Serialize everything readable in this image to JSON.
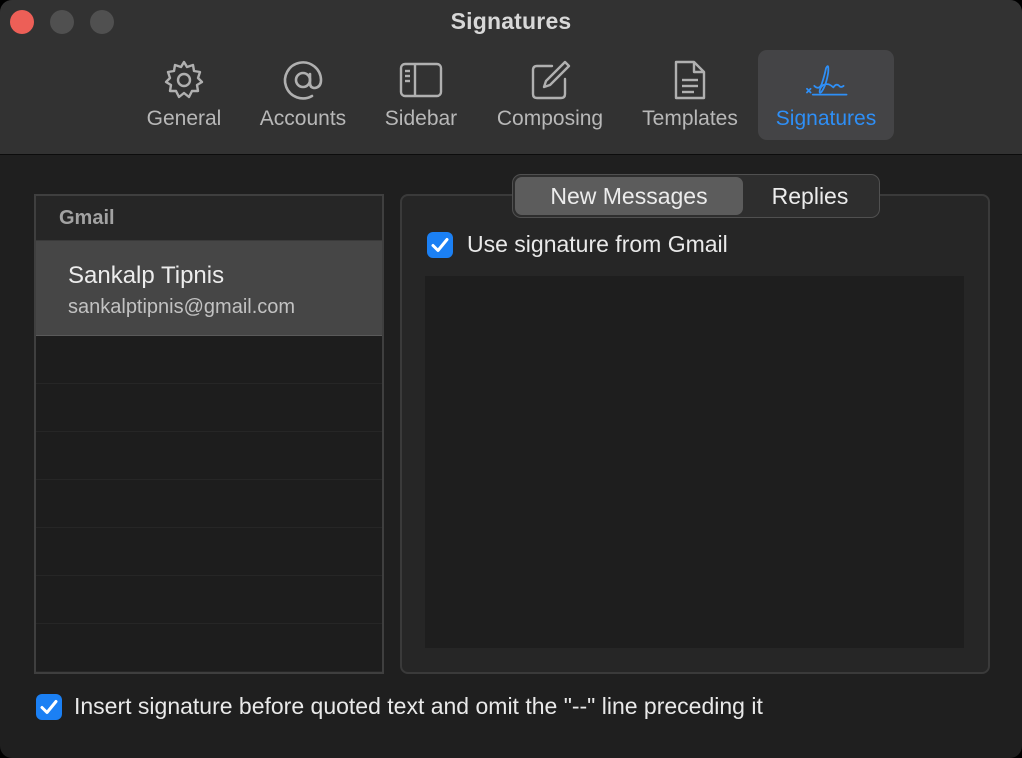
{
  "window": {
    "title": "Signatures"
  },
  "toolbar": {
    "items": [
      {
        "label": "General",
        "icon": "gear-icon"
      },
      {
        "label": "Accounts",
        "icon": "at-sign-icon"
      },
      {
        "label": "Sidebar",
        "icon": "sidebar-icon"
      },
      {
        "label": "Composing",
        "icon": "compose-icon"
      },
      {
        "label": "Templates",
        "icon": "document-icon"
      },
      {
        "label": "Signatures",
        "icon": "signature-icon",
        "active": true
      }
    ],
    "active_color": "#2e8ff7"
  },
  "accounts": {
    "group_label": "Gmail",
    "selected": {
      "name": "Sankalp Tipnis",
      "email": "sankalptipnis@gmail.com"
    }
  },
  "signature_tabs": {
    "new_messages": "New Messages",
    "replies": "Replies",
    "selected": "New Messages"
  },
  "use_signature": {
    "label": "Use signature from Gmail",
    "checked": true
  },
  "insert_before_quoted": {
    "label": "Insert signature before quoted text and omit the \"--\" line preceding it",
    "checked": true
  },
  "colors": {
    "accent": "#1b80f4",
    "close": "#ed5f57"
  }
}
